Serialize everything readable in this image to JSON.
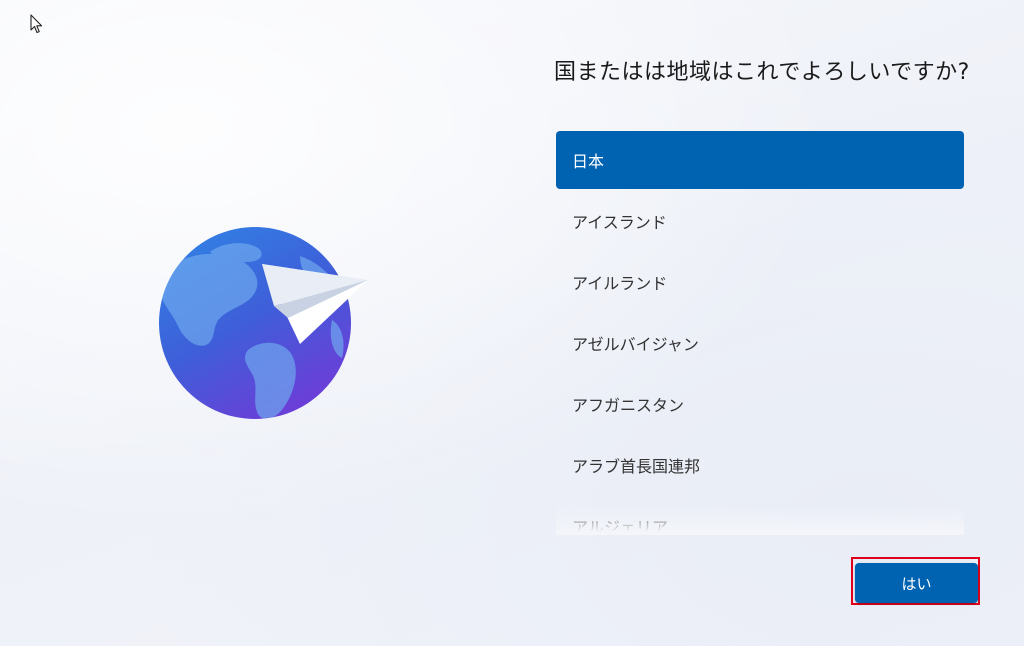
{
  "setup": {
    "title": "国またはは地域はこれでよろしいですか?",
    "countries": [
      {
        "label": "日本",
        "selected": true
      },
      {
        "label": "アイスランド",
        "selected": false
      },
      {
        "label": "アイルランド",
        "selected": false
      },
      {
        "label": "アゼルバイジャン",
        "selected": false
      },
      {
        "label": "アフガニスタン",
        "selected": false
      },
      {
        "label": "アラブ首長国連邦",
        "selected": false
      },
      {
        "label": "アルジェリア",
        "selected": false
      }
    ],
    "yes_label": "はい"
  },
  "colors": {
    "accent": "#0063b1",
    "highlight_outline": "#e0001b",
    "globe_top": "#2f7fe0",
    "globe_bottom": "#6a3fd8"
  },
  "icons": {
    "cursor": "mouse-pointer-icon",
    "illustration": "globe-paper-plane-icon"
  }
}
